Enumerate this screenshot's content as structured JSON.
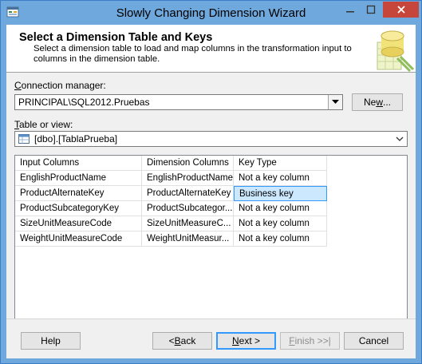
{
  "window": {
    "title": "Slowly Changing Dimension Wizard",
    "icon": "wizard-app-icon"
  },
  "header": {
    "title": "Select a Dimension Table and Keys",
    "description": "Select a dimension table to load and map columns in the transformation input to columns in the dimension table."
  },
  "connection": {
    "label_accel": "C",
    "label_rest": "onnection manager:",
    "value": "PRINCIPAL\\SQL2012.Pruebas",
    "new_button_prefix": "Ne",
    "new_button_accel": "w",
    "new_button_suffix": "..."
  },
  "table": {
    "label_accel": "T",
    "label_rest": "able or view:",
    "value": "[dbo].[TablaPrueba]"
  },
  "grid": {
    "headers": [
      "Input Columns",
      "Dimension Columns",
      "Key Type"
    ],
    "rows": [
      [
        "EnglishProductName",
        "EnglishProductName",
        "Not a key column"
      ],
      [
        "ProductAlternateKey",
        "ProductAlternateKey",
        "Business key"
      ],
      [
        "ProductSubcategoryKey",
        "ProductSubcategor...",
        "Not a key column"
      ],
      [
        "SizeUnitMeasureCode",
        "SizeUnitMeasureC...",
        "Not a key column"
      ],
      [
        "WeightUnitMeasureCode",
        "WeightUnitMeasur...",
        "Not a key column"
      ]
    ]
  },
  "buttons": {
    "help": "Help",
    "back_prefix": "< ",
    "back_accel": "B",
    "back_rest": "ack",
    "next_accel": "N",
    "next_rest": "ext >",
    "finish_accel": "F",
    "finish_rest": "inish >>|",
    "cancel": "Cancel"
  },
  "colors": {
    "titlebar": "#6fa8dc",
    "close": "#c7463b",
    "selection": "#cce8ff",
    "focus_border": "#3399ff"
  }
}
